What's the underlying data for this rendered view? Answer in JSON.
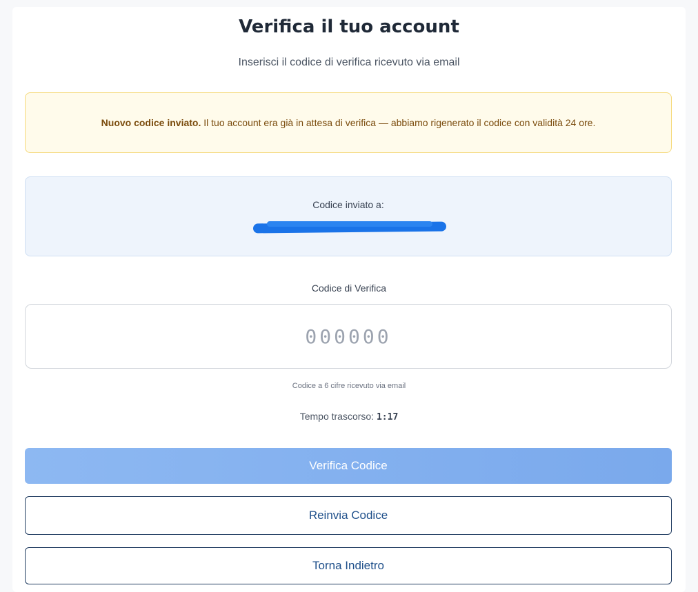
{
  "header": {
    "title": "Verifica il tuo account",
    "subtitle": "Inserisci il codice di verifica ricevuto via email"
  },
  "alert": {
    "strong": "Nuovo codice inviato.",
    "text": "Il tuo account era già in attesa di verifica — abbiamo rigenerato il codice con validità 24 ore."
  },
  "email": {
    "label": "Codice inviato a:",
    "redacted": true
  },
  "code_field": {
    "label": "Codice di Verifica",
    "placeholder": "000000",
    "value": "",
    "hint": "Codice a 6 cifre ricevuto via email"
  },
  "timer": {
    "label": "Tempo trascorso:",
    "value": "1:17"
  },
  "buttons": {
    "verify": "Verifica Codice",
    "resend": "Reinvia Codice",
    "back": "Torna Indietro"
  },
  "colors": {
    "primary_button": "#7aa9ec",
    "alert_bg": "#fffbeb",
    "alert_border": "#f5d97a",
    "email_box_bg": "#eef4fc",
    "redaction": "#1a73e8",
    "outline_border": "#1e3a5f"
  }
}
